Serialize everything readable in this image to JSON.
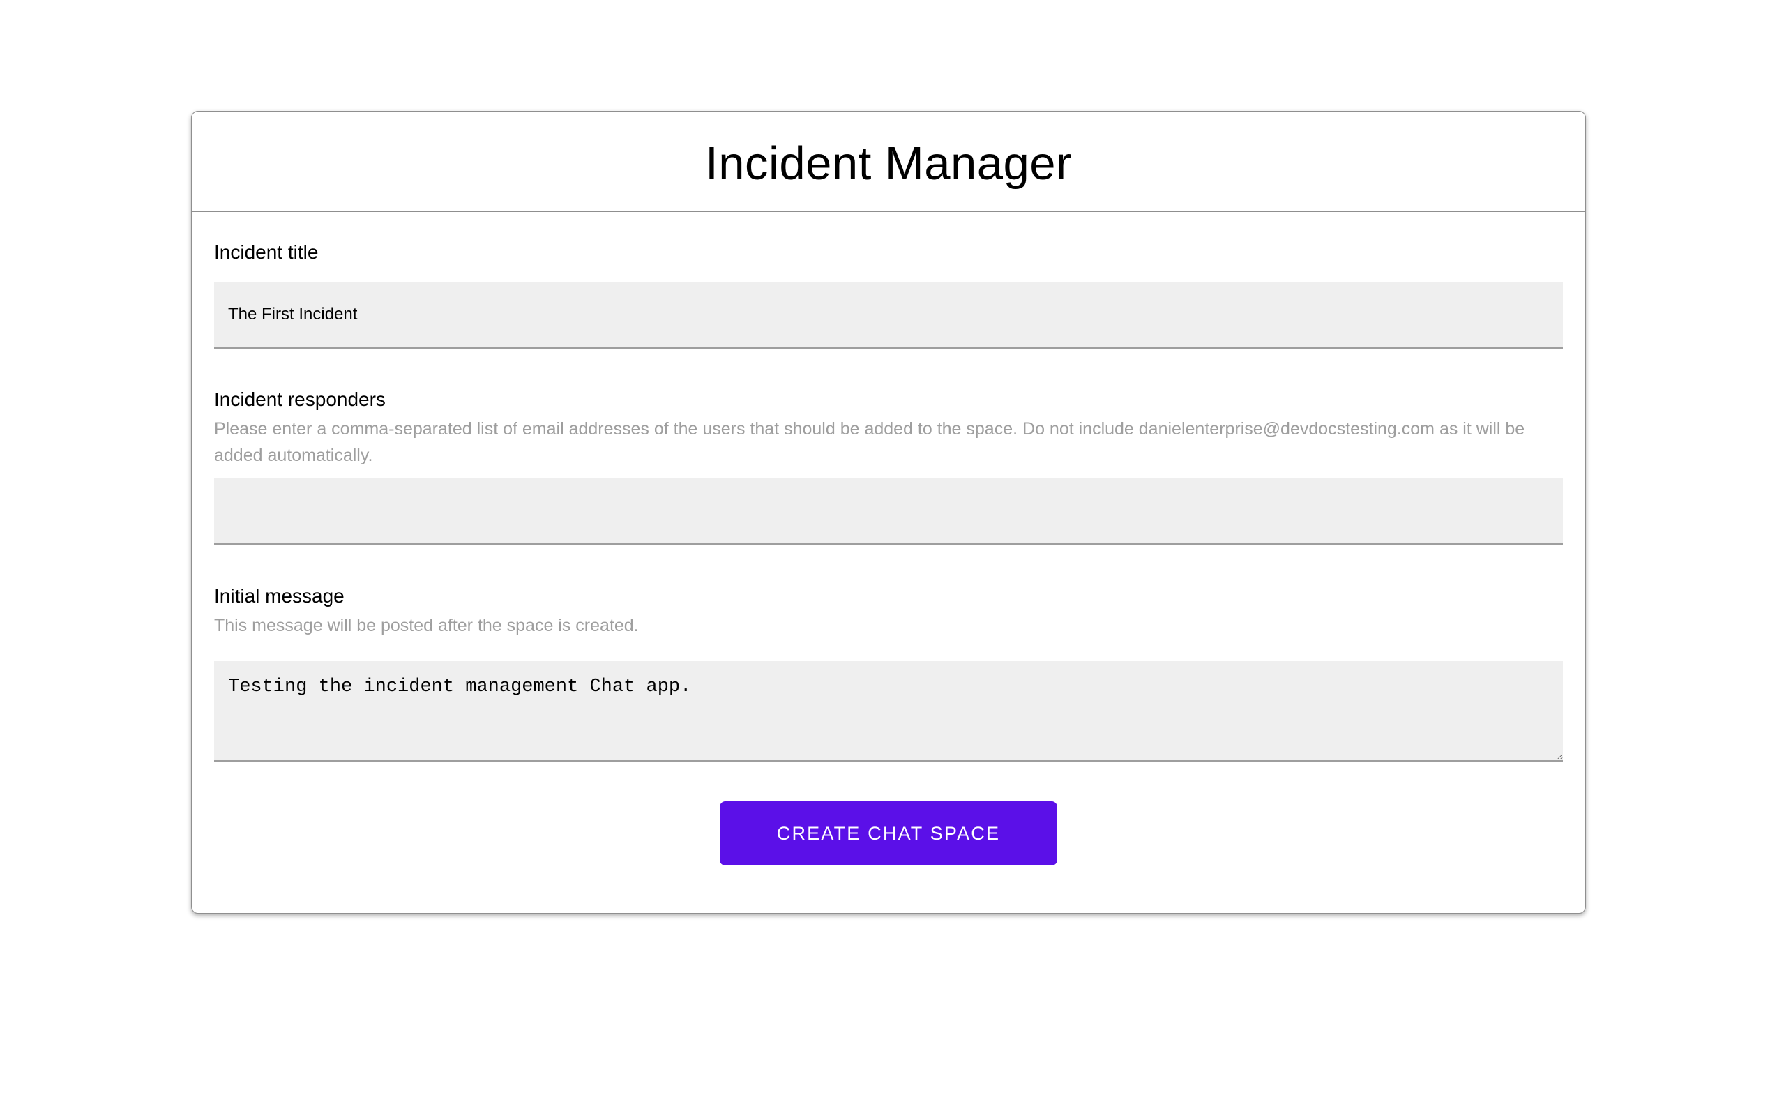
{
  "app": {
    "title": "Incident Manager"
  },
  "form": {
    "incident_title": {
      "label": "Incident title",
      "value": "The First Incident"
    },
    "incident_responders": {
      "label": "Incident responders",
      "helper": "Please enter a comma-separated list of email addresses of the users that should be added to the space. Do not include danielenterprise@devdocstesting.com as it will be added automatically.",
      "value": ""
    },
    "initial_message": {
      "label": "Initial message",
      "helper": "This message will be posted after the space is created.",
      "value": "Testing the incident management Chat app."
    }
  },
  "actions": {
    "create_button_label": "CREATE CHAT SPACE"
  },
  "colors": {
    "accent": "#5b10e8",
    "input_background": "#efefef",
    "input_underline": "#9e9e9e",
    "helper_text": "#9e9e9e",
    "card_border": "#8f8f8f"
  }
}
